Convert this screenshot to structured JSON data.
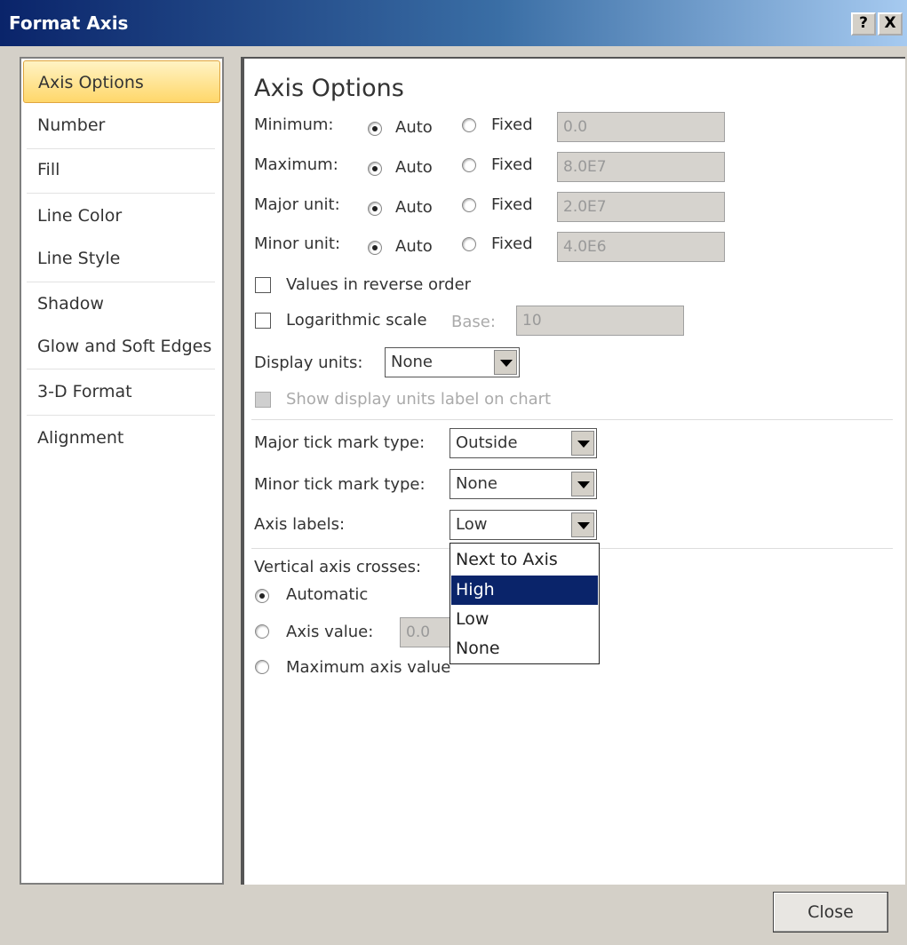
{
  "window": {
    "title": "Format Axis",
    "help_button": "?",
    "close_button": "X"
  },
  "nav": {
    "items": [
      {
        "label": "Axis Options",
        "selected": true
      },
      {
        "label": "Number"
      },
      {
        "label": "Fill"
      },
      {
        "label": "Line Color"
      },
      {
        "label": "Line Style"
      },
      {
        "label": "Shadow"
      },
      {
        "label": "Glow and Soft Edges"
      },
      {
        "label": "3-D Format"
      },
      {
        "label": "Alignment"
      }
    ]
  },
  "panel": {
    "heading": "Axis Options",
    "rows": [
      {
        "label": "Minimum:",
        "auto": "Auto",
        "fixed": "Fixed",
        "value": "0.0"
      },
      {
        "label": "Maximum:",
        "auto": "Auto",
        "fixed": "Fixed",
        "value": "8.0E7"
      },
      {
        "label": "Major unit:",
        "auto": "Auto",
        "fixed": "Fixed",
        "value": "2.0E7"
      },
      {
        "label": "Minor unit:",
        "auto": "Auto",
        "fixed": "Fixed",
        "value": "4.0E6"
      }
    ],
    "reverse_order": "Values in reverse order",
    "log_scale": "Logarithmic scale",
    "base_label": "Base:",
    "base_value": "10",
    "display_units_label": "Display units:",
    "display_units_value": "None",
    "show_units_label": "Show display units label on chart",
    "major_tick_label": "Major tick mark type:",
    "major_tick_value": "Outside",
    "minor_tick_label": "Minor tick mark type:",
    "minor_tick_value": "None",
    "axis_labels_label": "Axis labels:",
    "axis_labels_value": "Low",
    "crosses_label": "Vertical axis crosses:",
    "crosses_automatic": "Automatic",
    "crosses_axis_value": "Axis value:",
    "crosses_axis_value_input": "0.0",
    "crosses_max": "Maximum axis value"
  },
  "dropdown": {
    "options": [
      "Next to Axis",
      "High",
      "Low",
      "None"
    ],
    "highlighted": "High"
  },
  "footer": {
    "close_label": "Close"
  }
}
